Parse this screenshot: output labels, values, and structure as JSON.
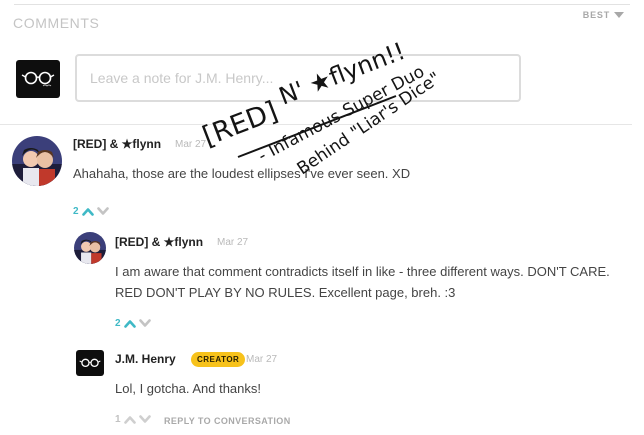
{
  "header": {
    "title": "COMMENTS",
    "sort_label": "BEST"
  },
  "composer": {
    "placeholder": "Leave a note for J.M. Henry..."
  },
  "comments": [
    {
      "author": "[RED] & ★flynn",
      "date": "Mar 27",
      "text": "Ahahaha, those are the loudest ellipses I've ever seen. XD",
      "votes": "2"
    },
    {
      "author": "[RED] & ★flynn",
      "date": "Mar 27",
      "text": "I am aware that comment contradicts itself in like - three different ways. DON'T CARE. RED DON'T PLAY BY NO RULES. Excellent page, breh. :3",
      "votes": "2"
    },
    {
      "author": "J.M. Henry",
      "badge": "CREATOR",
      "date": "Mar 27",
      "text": "Lol, I gotcha. And thanks!",
      "votes": "1",
      "reply_label": "REPLY TO CONVERSATION"
    }
  ],
  "overlay": {
    "line1_bracket": "[RED]",
    "line1_rest": "N' ★flynn!!",
    "line2": "- Infamous Super Duo",
    "line3": "Behind \"Liar's Dice\""
  },
  "colors": {
    "accent_teal": "#3fb9c6",
    "creator_badge": "#f7c21b",
    "overlay_red": "#a02a2a",
    "overlay_ink": "#141414"
  },
  "icons": {
    "upvote": "chevron-up-icon",
    "downvote": "chevron-down-icon",
    "sort": "triangle-down-icon"
  }
}
